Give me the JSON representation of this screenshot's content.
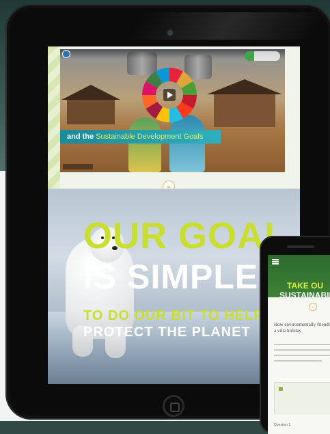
{
  "video": {
    "banner_prefix": "and the",
    "banner_highlight": "Sustainable Development Goals"
  },
  "hero": {
    "line1": "OUR GOAL",
    "line2": "IS SIMPLE",
    "line3": "TO DO OUR BIT TO HELP",
    "line4": "PROTECT THE PLANET"
  },
  "phone": {
    "title_line1": "TAKE OU",
    "title_line2": "SUSTAINABILIT",
    "question": "How environmentally friendly\na villa holiday",
    "question_label": "Question 1"
  },
  "colors": {
    "accent_green": "#c9de2e",
    "banner_teal": "#1b8a9a",
    "phone_header": "#2e6b2f",
    "arrow_orange": "#e59b2e"
  },
  "icons": {
    "scroll": "chevron-down-icon",
    "play": "play-icon",
    "home": "home-button-icon"
  }
}
